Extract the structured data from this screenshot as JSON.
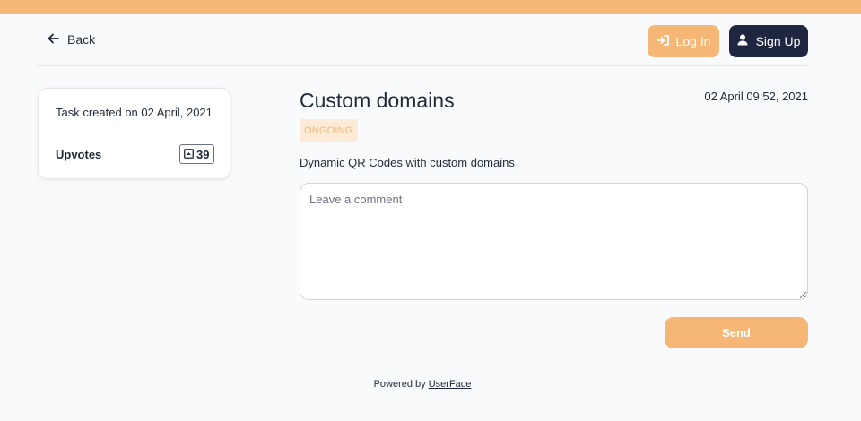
{
  "colors": {
    "accent": "#f6b776",
    "dark_button": "#1f2640",
    "badge_bg": "#fdebd7",
    "text": "#1f2937"
  },
  "header": {
    "back_label": "Back",
    "back_icon": "arrow-left-icon",
    "login_label": "Log In",
    "login_icon": "sign-in-icon",
    "signup_label": "Sign Up",
    "signup_icon": "user-icon"
  },
  "sidebar": {
    "created_text": "Task created on 02 April, 2021",
    "upvotes_label": "Upvotes",
    "upvote_icon": "caret-up-square-icon",
    "upvote_count": "39"
  },
  "task": {
    "title": "Custom domains",
    "date": "02 April 09:52, 2021",
    "status": "ONGOING",
    "description": "Dynamic QR Codes with custom domains"
  },
  "comment": {
    "placeholder": "Leave a comment",
    "value": "",
    "send_label": "Send"
  },
  "footer": {
    "powered_by": "Powered by",
    "brand_link": "UserFace"
  }
}
